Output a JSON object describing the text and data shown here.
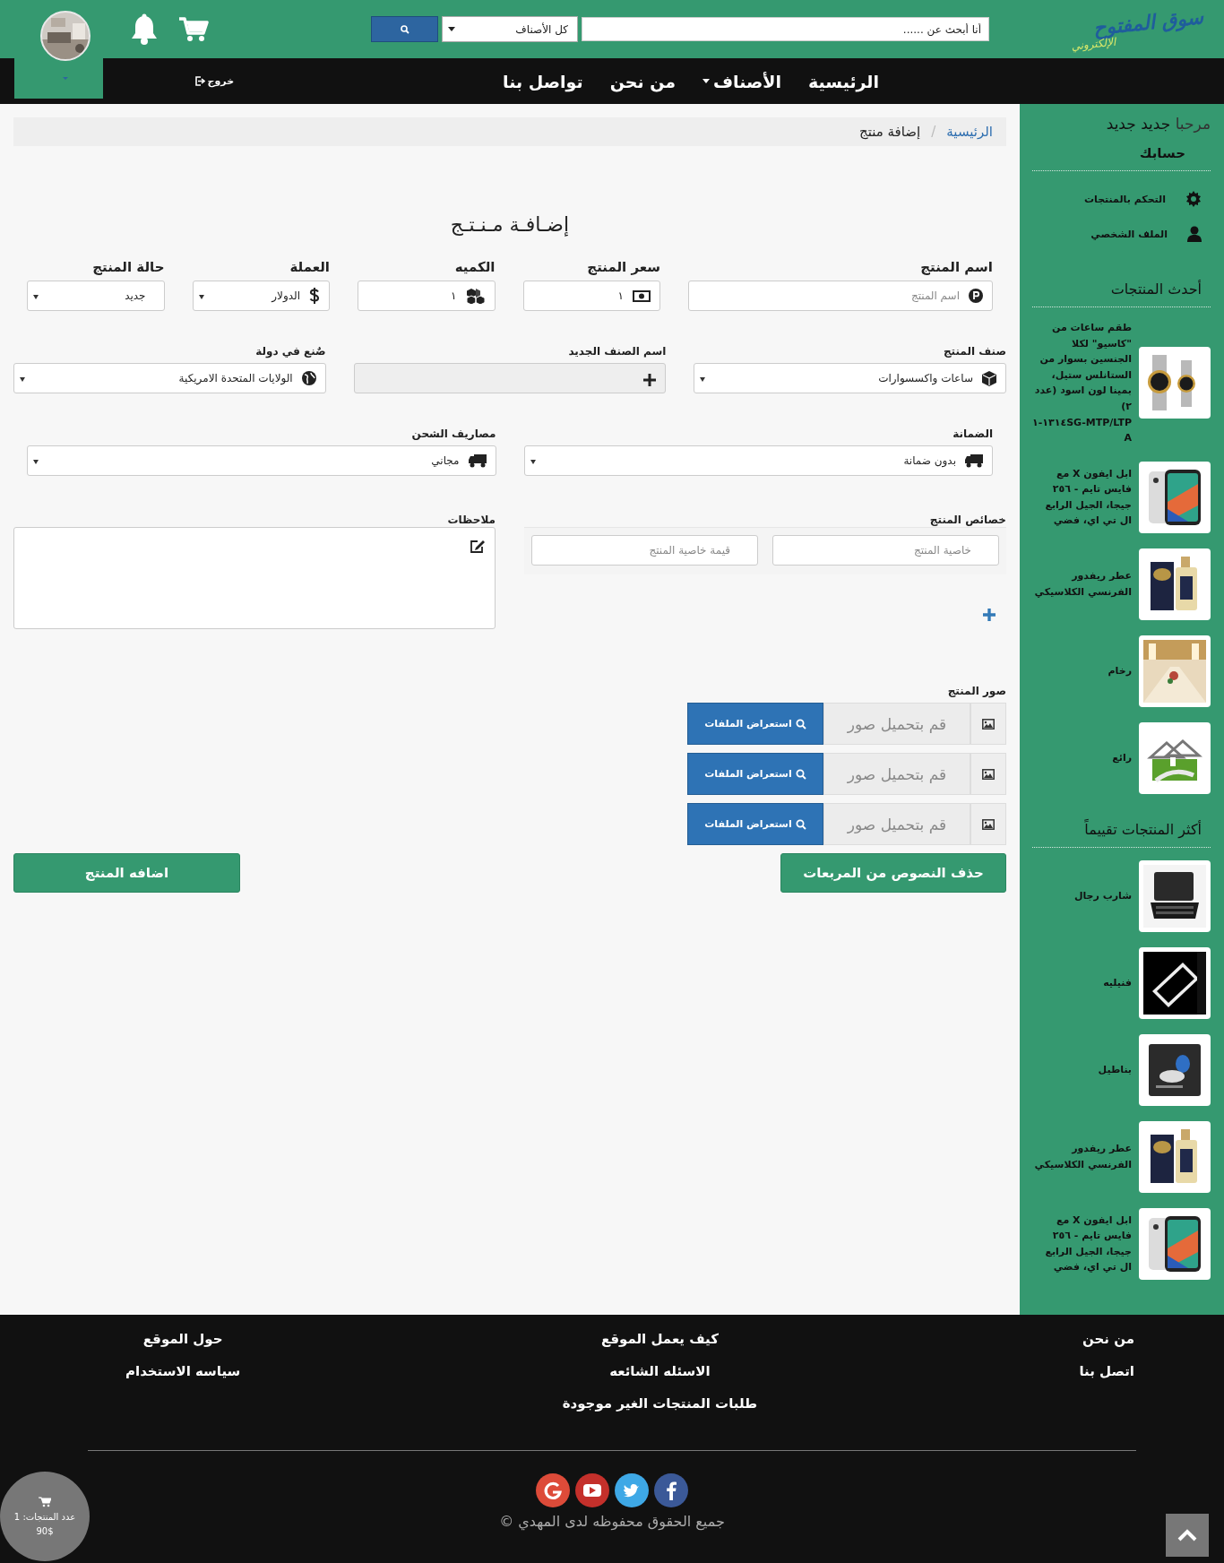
{
  "header": {
    "logo": {
      "line1": "سوق المفتوح",
      "line2": "الإلكتروني"
    },
    "search": {
      "placeholder": "أنا أبحث عن ......"
    },
    "category_select": "كل الأصناف"
  },
  "nav": {
    "items": [
      {
        "label": "الرئيسية",
        "dropdown": false
      },
      {
        "label": "الأصناف",
        "dropdown": true
      },
      {
        "label": "من نحن",
        "dropdown": false
      },
      {
        "label": "تواصل بنا",
        "dropdown": false
      }
    ],
    "logout": "خروج"
  },
  "breadcrumb": {
    "separator": "/",
    "items": [
      {
        "label": "الرئيسية",
        "selected": false
      },
      {
        "label": "إضافة منتج",
        "selected": true
      }
    ]
  },
  "form": {
    "title": "إضـافـة مـنـتـج",
    "groups": [
      {
        "fields": [
          {
            "label": "اسم المنتج",
            "kind": "input",
            "placeholder": "اسم المنتج"
          },
          {
            "label": "سعر المنتج",
            "kind": "input",
            "value": "١"
          },
          {
            "label": "الكميه",
            "kind": "input",
            "value": "١"
          },
          {
            "label": "العملة",
            "kind": "select",
            "value": "الدولار"
          },
          {
            "label": "حالة المنتج",
            "kind": "select",
            "value": "جديد"
          }
        ]
      },
      {
        "fields": [
          {
            "label": "صنف المنتج",
            "kind": "select",
            "value": "ساعات واكسسوارات"
          },
          {
            "label": "اسم الصنف الجديد",
            "kind": "add"
          },
          {
            "label": "صٌنع في دولة",
            "kind": "select",
            "value": "الولايات المتحدة الامريكية"
          }
        ]
      },
      {
        "fields": [
          {
            "label": "الضمانة",
            "kind": "select",
            "value": "بدون ضمانة"
          },
          {
            "label": "مصاريف الشحن",
            "kind": "select",
            "value": "مجاني"
          }
        ]
      }
    ],
    "properties": {
      "label": "خصائص المنتج",
      "name_placeholder": "خاصية المنتج",
      "value_placeholder": "قيمة خاصية المنتج"
    },
    "notes": {
      "label": "ملاحظات"
    },
    "images": {
      "label": "صور المنتج",
      "rows": [
        {
          "placeholder": "قم بتحميل صور",
          "button": "استعراض الملفات"
        },
        {
          "placeholder": "قم بتحميل صور",
          "button": "استعراض الملفات"
        },
        {
          "placeholder": "قم بتحميل صور",
          "button": "استعراض الملفات"
        }
      ]
    },
    "clear_button": "حذف النصوص من المربعات",
    "submit_button": "اضافه المنتج"
  },
  "sidebar": {
    "greeting": "مرحبا",
    "user": "جديد جديد",
    "account_title": "حسابك",
    "links": [
      "التحكم بالمنتجات",
      "الملف الشخصي"
    ],
    "latest_title": "أحدث المنتجات",
    "latest": [
      {
        "name": "طقم ساعات من \"كاسيو\" لكلا الجنسين بسوار من الستانلس ستيل، بمينا لون اسود (عدد ٢) MTP/LTP-١٣١٤SG-١A"
      },
      {
        "name": "ابل ايفون X مع فايس تايم - ٢٥٦ جيجا، الجيل الرابع ال تي اي، فضي"
      },
      {
        "name": "عطر ريفدور الفرنسي الكلاسيكي"
      },
      {
        "name": "رخام"
      },
      {
        "name": "رائع"
      }
    ],
    "top_title": "أكثر المنتجات تقييماً",
    "top": [
      {
        "name": "شارب رجال"
      },
      {
        "name": "فنيليه"
      },
      {
        "name": "بناطيل"
      },
      {
        "name": "عطر ريفدور الفرنسي الكلاسيكي"
      },
      {
        "name": "ابل ايفون X مع فايس تايم - ٢٥٦ جيجا، الجيل الرابع ال تي اي، فضي"
      }
    ]
  },
  "footer": {
    "columns": [
      [
        "من نحن",
        "اتصل بنا"
      ],
      [
        "كيف يعمل الموقع",
        "الاسئله الشائعه",
        "طلبات المنتجات الغير موجودة"
      ],
      [
        "حول الموقع",
        "سياسه الاستخدام"
      ]
    ],
    "copyright": "جميع الحقوق محفوظه لدى المهدي ©",
    "cart": {
      "count": "عدد المنتجات: 1",
      "total": "90$"
    }
  }
}
